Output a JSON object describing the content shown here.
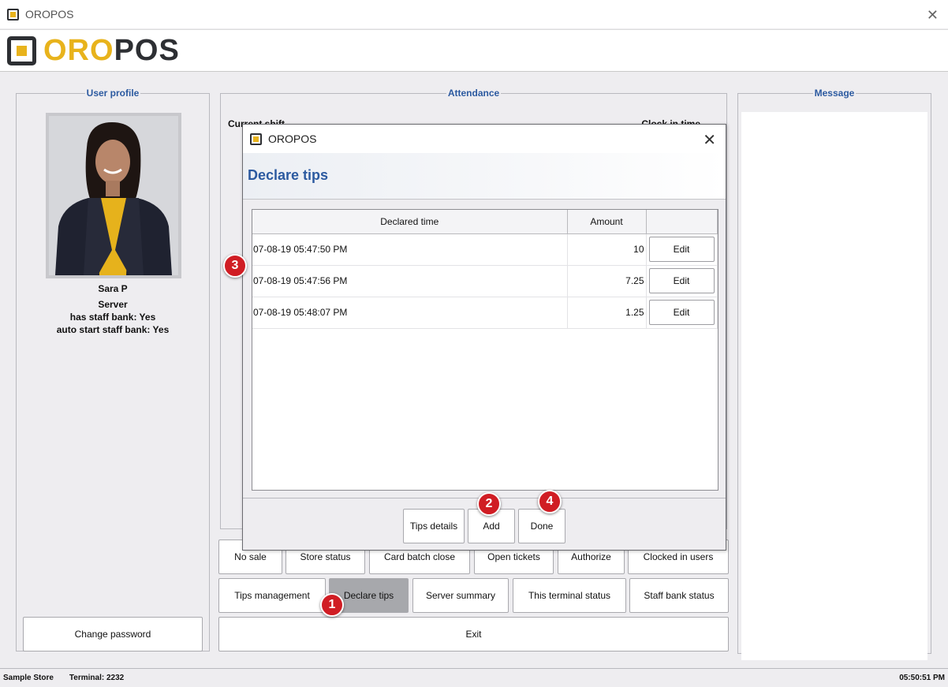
{
  "window": {
    "title": "OROPOS",
    "close_glyph": "✕"
  },
  "logo": {
    "oro": "ORO",
    "pos": "POS"
  },
  "user_profile": {
    "legend": "User profile",
    "name": "Sara P",
    "role": "Server",
    "staff_bank": "has staff bank: Yes",
    "auto_staff_bank": "auto start staff bank: Yes",
    "change_password": "Change password"
  },
  "attendance": {
    "legend": "Attendance",
    "current_shift": "Current shift",
    "clock_in_time": "Clock in time"
  },
  "message": {
    "legend": "Message"
  },
  "actions": {
    "row1": [
      "No sale",
      "Store status",
      "Card batch close",
      "Open tickets",
      "Authorize",
      "Clocked in users"
    ],
    "row2": [
      "Tips management",
      "Declare tips",
      "Server summary",
      "This terminal status",
      "Staff bank status"
    ],
    "exit": "Exit"
  },
  "dialog": {
    "title": "OROPOS",
    "heading": "Declare tips",
    "close_glyph": "✕",
    "columns": [
      "Declared time",
      "Amount",
      ""
    ],
    "rows": [
      {
        "time": "07-08-19 05:47:50 PM",
        "amount": "10",
        "action": "Edit"
      },
      {
        "time": "07-08-19 05:47:56 PM",
        "amount": "7.25",
        "action": "Edit"
      },
      {
        "time": "07-08-19 05:48:07 PM",
        "amount": "1.25",
        "action": "Edit"
      }
    ],
    "buttons": {
      "tips_details": "Tips details",
      "add": "Add",
      "done": "Done"
    }
  },
  "status_bar": {
    "store": "Sample Store",
    "terminal": "Terminal: 2232",
    "time": "05:50:51 PM"
  },
  "badges": [
    "1",
    "2",
    "3",
    "4"
  ],
  "colors": {
    "accent_blue": "#2c5aa0",
    "logo_gold": "#e8b31c",
    "logo_dark": "#2d2f33",
    "badge_red": "#d01d24"
  }
}
